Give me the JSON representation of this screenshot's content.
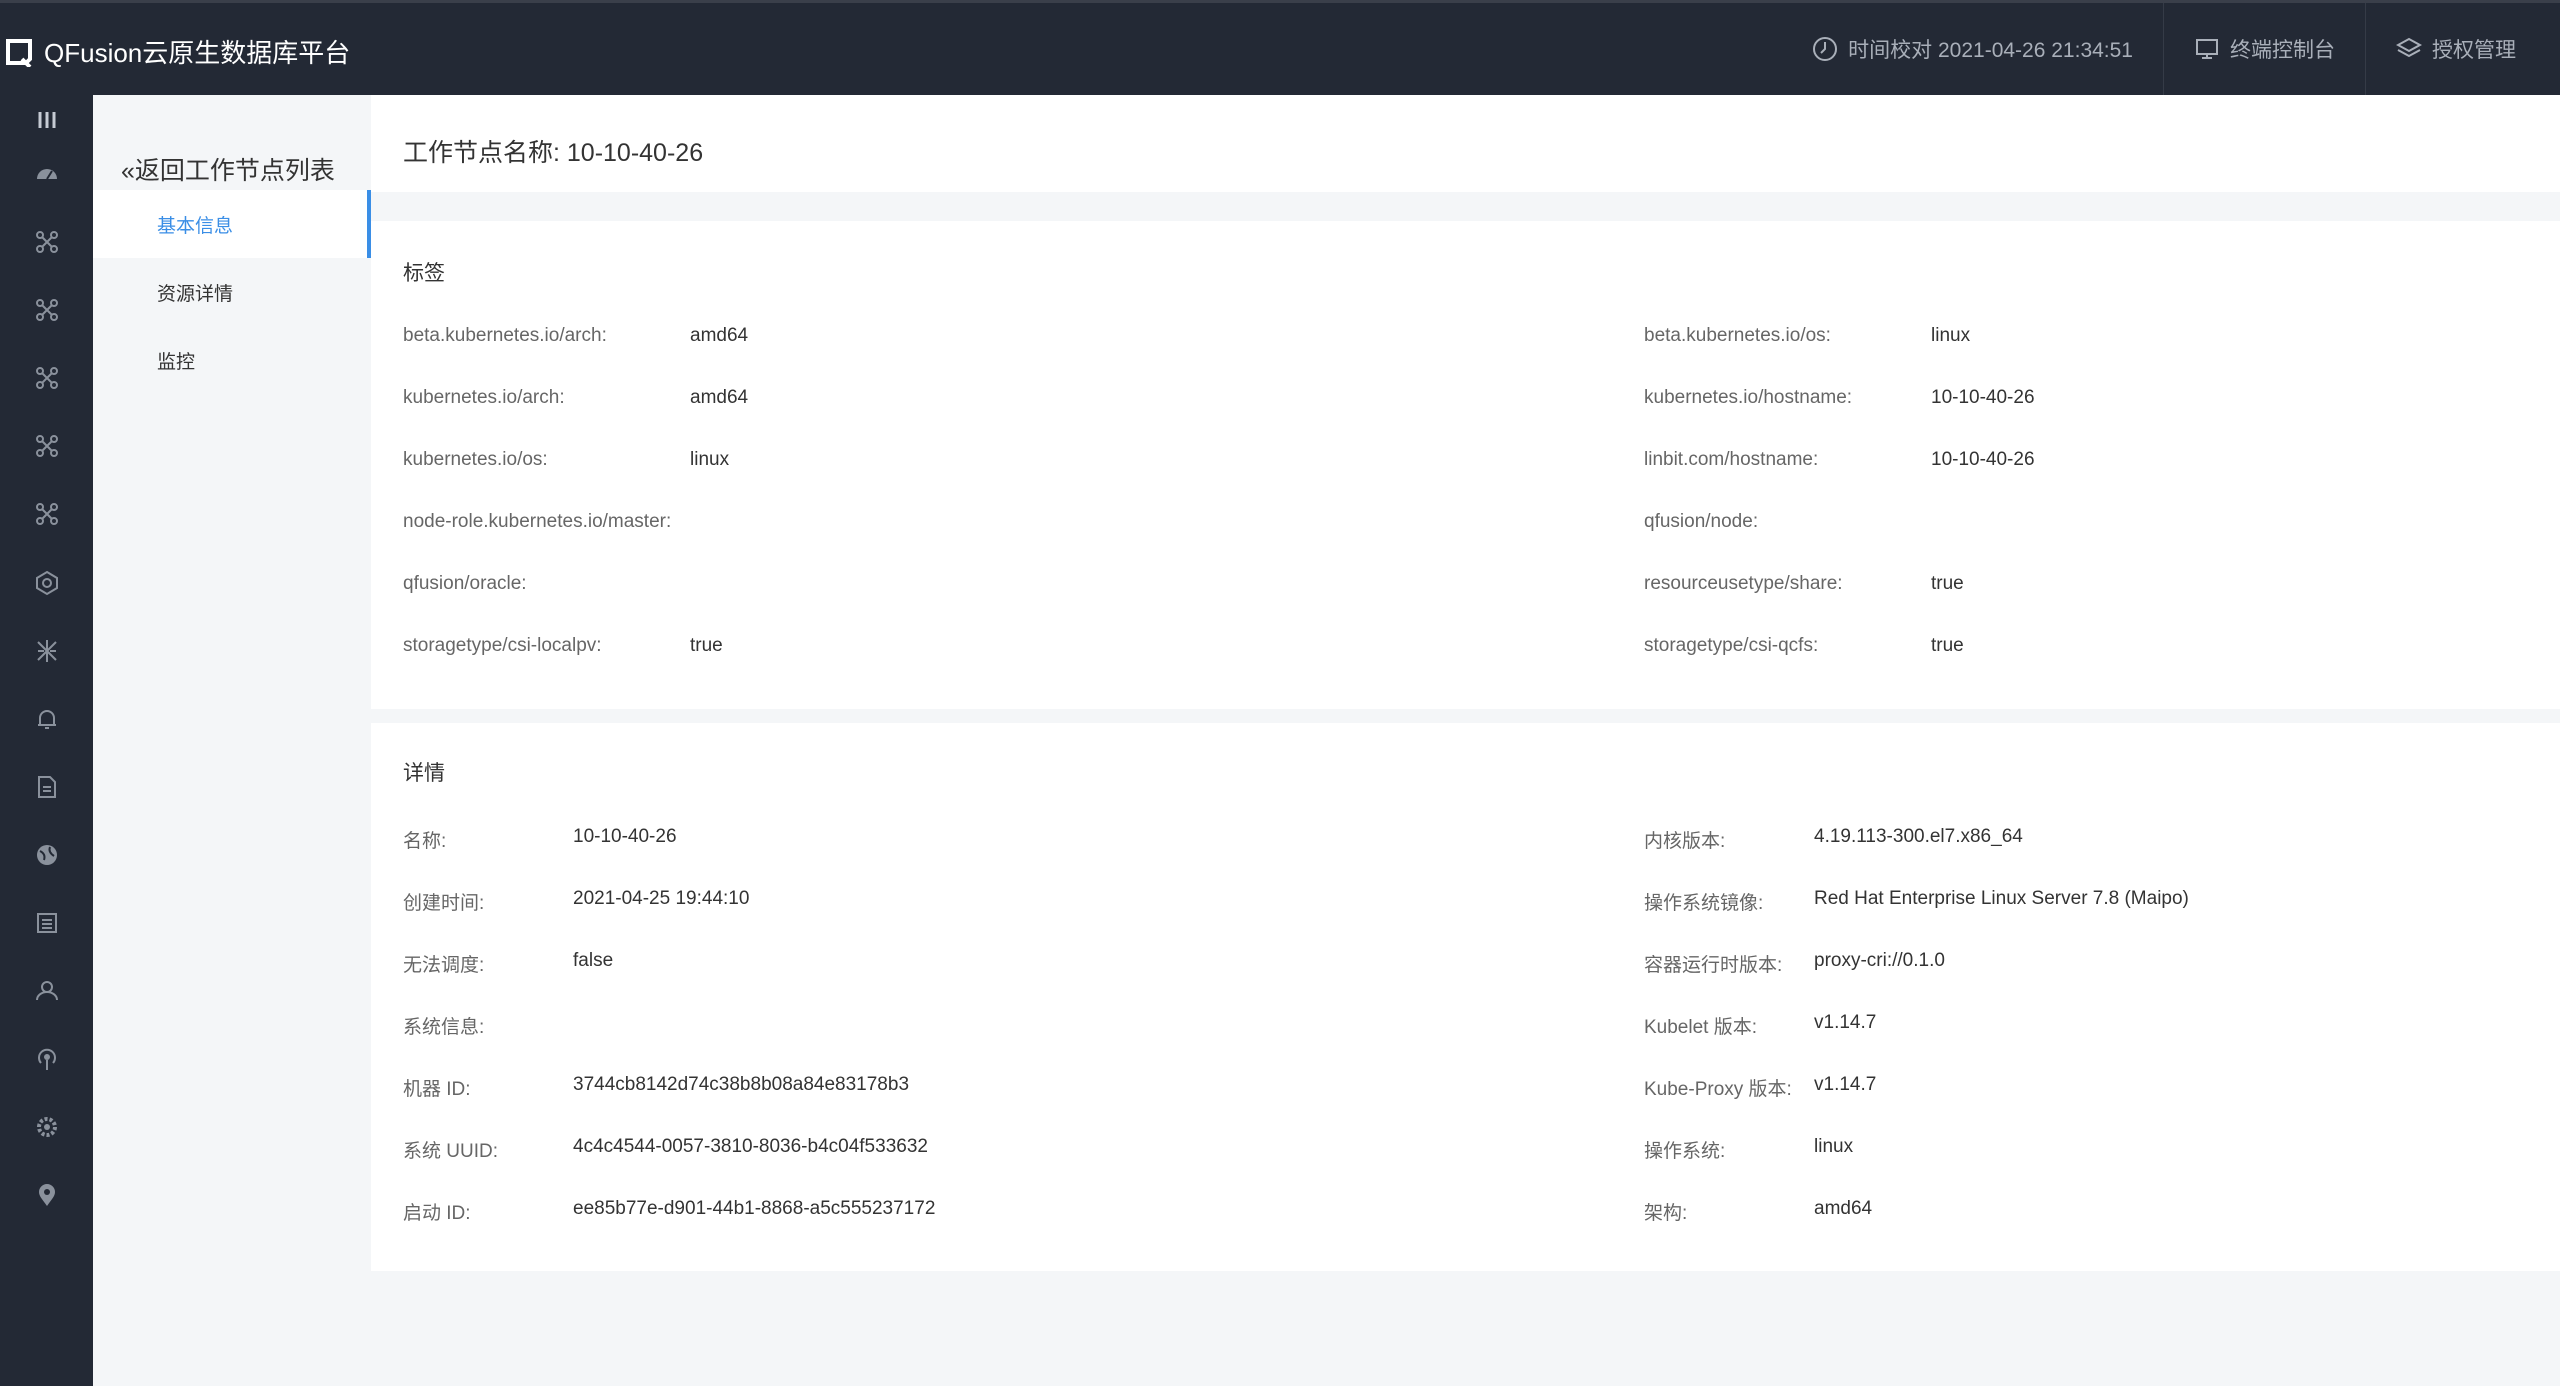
{
  "app": {
    "title": "QFusion云原生数据库平台"
  },
  "header": {
    "time_label": "时间校对 2021-04-26 21:34:51",
    "terminal_label": "终端控制台",
    "license_label": "授权管理"
  },
  "subnav": {
    "back_label": "«返回工作节点列表",
    "items": [
      {
        "label": "基本信息"
      },
      {
        "label": "资源详情"
      },
      {
        "label": "监控"
      }
    ]
  },
  "page": {
    "title": "工作节点名称:  10-10-40-26"
  },
  "labels_section": {
    "title": "标签",
    "rows": [
      {
        "left_key": "beta.kubernetes.io/arch:",
        "left_value": "amd64",
        "right_key": "beta.kubernetes.io/os:",
        "right_value": "linux"
      },
      {
        "left_key": "kubernetes.io/arch:",
        "left_value": "amd64",
        "right_key": "kubernetes.io/hostname:",
        "right_value": "10-10-40-26"
      },
      {
        "left_key": "kubernetes.io/os:",
        "left_value": "linux",
        "right_key": "linbit.com/hostname:",
        "right_value": "10-10-40-26"
      },
      {
        "left_key": "node-role.kubernetes.io/master:",
        "left_value": "",
        "right_key": "qfusion/node:",
        "right_value": ""
      },
      {
        "left_key": "qfusion/oracle:",
        "left_value": "",
        "right_key": "resourceusetype/share:",
        "right_value": "true"
      },
      {
        "left_key": "storagetype/csi-localpv:",
        "left_value": "true",
        "right_key": "storagetype/csi-qcfs:",
        "right_value": "true"
      }
    ]
  },
  "details_section": {
    "title": "详情",
    "rows": [
      {
        "left_key": "名称:",
        "left_value": "10-10-40-26",
        "right_key": "内核版本:",
        "right_value": "4.19.113-300.el7.x86_64"
      },
      {
        "left_key": "创建时间:",
        "left_value": "2021-04-25 19:44:10",
        "right_key": "操作系统镜像:",
        "right_value": "Red Hat Enterprise Linux Server 7.8 (Maipo)"
      },
      {
        "left_key": "无法调度:",
        "left_value": "false",
        "right_key": "容器运行时版本:",
        "right_value": "proxy-cri://0.1.0"
      },
      {
        "left_key": "系统信息:",
        "left_value": "",
        "right_key": "Kubelet 版本:",
        "right_value": "v1.14.7"
      },
      {
        "left_key": "机器 ID:",
        "left_value": "3744cb8142d74c38b8b08a84e83178b3",
        "right_key": "Kube-Proxy 版本:",
        "right_value": "v1.14.7"
      },
      {
        "left_key": "系统 UUID:",
        "left_value": "4c4c4544-0057-3810-8036-b4c04f533632",
        "right_key": "操作系统:",
        "right_value": "linux"
      },
      {
        "left_key": "启动 ID:",
        "left_value": "ee85b77e-d901-44b1-8868-a5c555237172",
        "right_key": "架构:",
        "right_value": "amd64"
      }
    ]
  },
  "sidenav_icons": [
    "menu-icon",
    "dashboard-icon",
    "node-graph-icon",
    "node-graph-icon",
    "node-graph-icon",
    "node-graph-icon",
    "node-graph-icon",
    "hexagon-icon",
    "network-icon",
    "bell-icon",
    "document-icon",
    "globe-icon",
    "list-icon",
    "users-icon",
    "broadcast-icon",
    "settings-icon",
    "location-pin-icon"
  ],
  "colors": {
    "topbar": "#232935",
    "accent": "#3a8ee6",
    "page_bg": "#f4f6f8"
  }
}
